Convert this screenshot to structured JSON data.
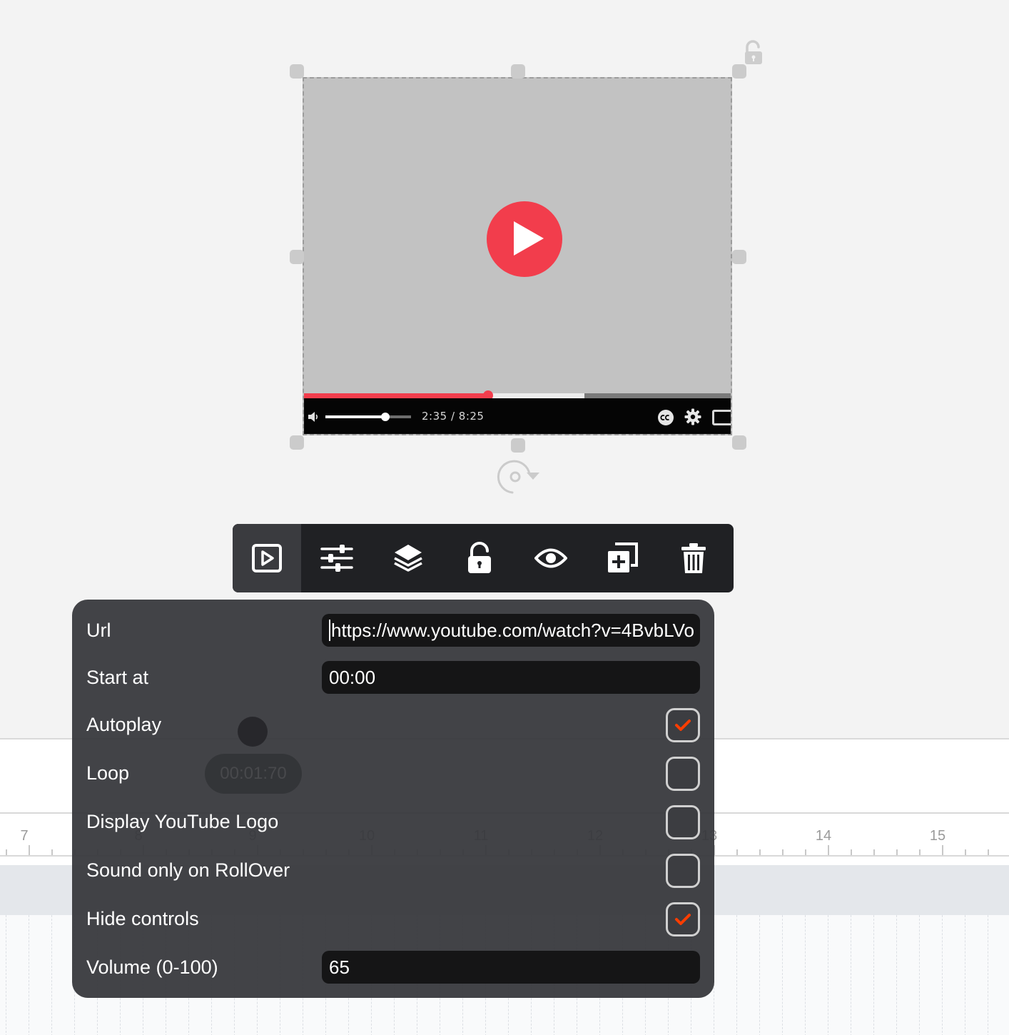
{
  "timeline": {
    "ruler_numbers": [
      "7",
      "8",
      "9",
      "10",
      "11",
      "12",
      "13",
      "14",
      "15"
    ],
    "marker_time": "00:01:70"
  },
  "video": {
    "time_display": "2:35 / 8:25",
    "progress_played_fraction": 0.43,
    "progress_buffered_fraction": 0.655,
    "volume_fraction": 0.7
  },
  "toolbar": {
    "buttons": [
      {
        "name": "video-settings",
        "icon": "play-square-icon",
        "active": true
      },
      {
        "name": "adjustments",
        "icon": "sliders-icon",
        "active": false
      },
      {
        "name": "layers",
        "icon": "layers-icon",
        "active": false
      },
      {
        "name": "lock",
        "icon": "unlock-icon",
        "active": false
      },
      {
        "name": "visibility",
        "icon": "eye-icon",
        "active": false
      },
      {
        "name": "duplicate",
        "icon": "duplicate-icon",
        "active": false
      },
      {
        "name": "delete",
        "icon": "trash-icon",
        "active": false
      }
    ]
  },
  "panel": {
    "url_label": "Url",
    "url_value": "https://www.youtube.com/watch?v=4BvbLVo",
    "start_label": "Start at",
    "start_value": "00:00",
    "autoplay_label": "Autoplay",
    "autoplay_checked": true,
    "loop_label": "Loop",
    "loop_checked": false,
    "logo_label": "Display YouTube Logo",
    "logo_checked": false,
    "sound_label": "Sound only on RollOver",
    "sound_checked": false,
    "hide_label": "Hide controls",
    "hide_checked": true,
    "volume_label": "Volume (0-100)",
    "volume_value": "65"
  },
  "colors": {
    "accent_red": "#f23d4c",
    "check_orange": "#ff3d00",
    "panel_bg": "#36373b",
    "toolbar_bg": "#202124"
  }
}
